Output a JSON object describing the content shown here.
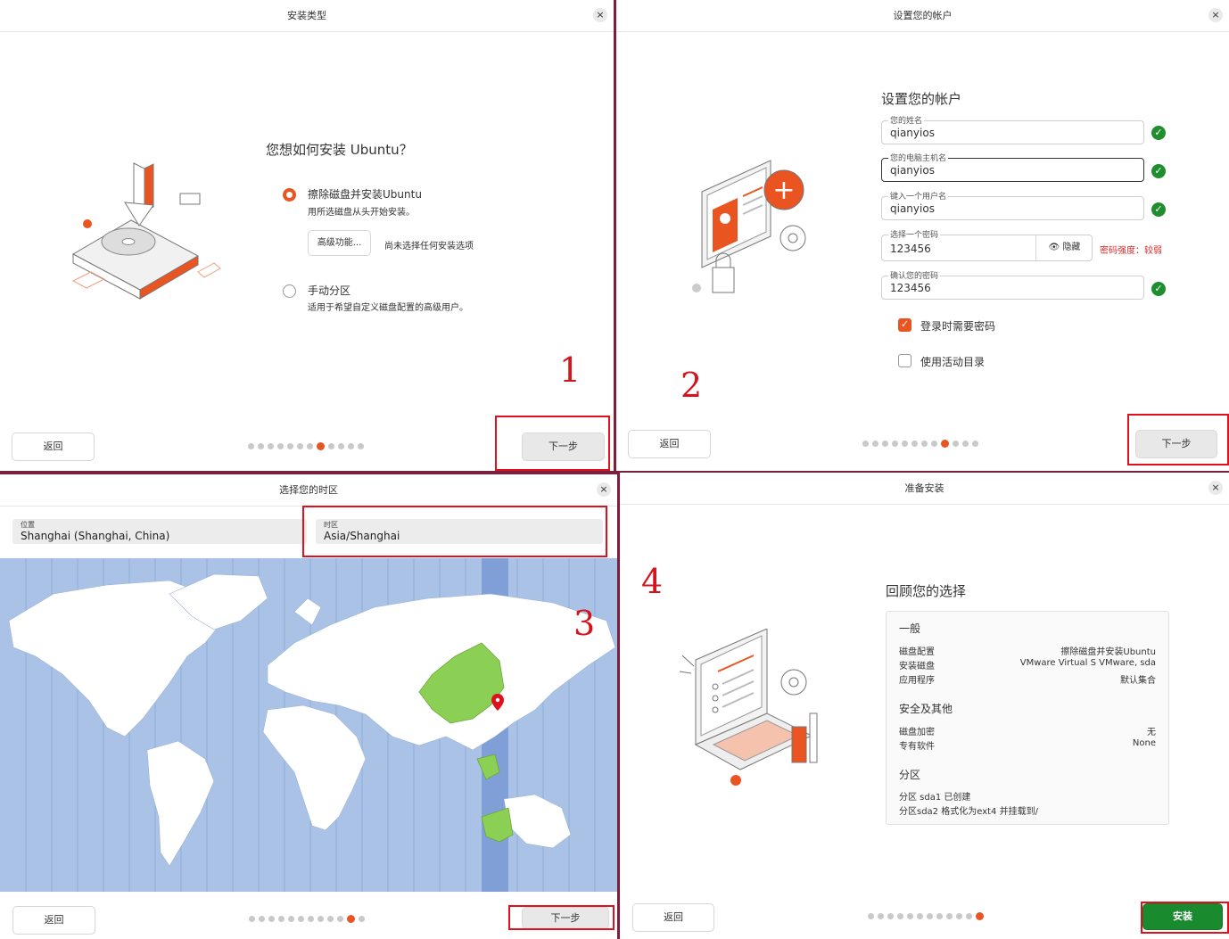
{
  "w1": {
    "title": "安装类型",
    "close": "×",
    "question": "您想如何安装 Ubuntu？",
    "option_erase": {
      "title": "擦除磁盘并安装Ubuntu",
      "desc": "用所选磁盘从头开始安装。"
    },
    "advanced_btn": "高级功能...",
    "advanced_status": "尚未选择任何安装选项",
    "option_manual": {
      "title": "手动分区",
      "desc": "适用于希望自定义磁盘配置的高级用户。"
    },
    "back": "返回",
    "next": "下一步",
    "step_label": "1"
  },
  "w2": {
    "title": "设置您的帐户",
    "close": "×",
    "heading": "设置您的帐户",
    "fields": [
      {
        "label": "您的姓名",
        "value": "qianyios",
        "valid": true
      },
      {
        "label": "您的电脑主机名",
        "value": "qianyios",
        "valid": true
      },
      {
        "label": "键入一个用户名",
        "value": "qianyios",
        "valid": true
      },
      {
        "label": "选择一个密码",
        "value": "123456"
      },
      {
        "label": "确认您的密码",
        "value": "123456",
        "valid": true
      }
    ],
    "hide_label": "隐藏",
    "strength": "密码强度：较弱",
    "require_password": "登录时需要密码",
    "active_directory": "使用活动目录",
    "check_mark": "✓",
    "back": "返回",
    "next": "下一步",
    "step_label": "2"
  },
  "w3": {
    "title": "选择您的时区",
    "close": "×",
    "location_label": "位置",
    "location_value": "Shanghai (Shanghai, China)",
    "timezone_label": "时区",
    "timezone_value": "Asia/Shanghai",
    "back": "返回",
    "next": "下一步",
    "step_label": "3"
  },
  "w4": {
    "title": "准备安装",
    "close": "×",
    "heading": "回顾您的选择",
    "general": "一般",
    "rows_general": [
      {
        "k": "磁盘配置",
        "v": "擦除磁盘并安装Ubuntu"
      },
      {
        "k": "安装磁盘",
        "v": "VMware Virtual S VMware, sda"
      },
      {
        "k": "应用程序",
        "v": "默认集合"
      }
    ],
    "security": "安全及其他",
    "rows_security": [
      {
        "k": "磁盘加密",
        "v": "无"
      },
      {
        "k": "专有软件",
        "v": "None"
      }
    ],
    "partitions": "分区",
    "part_lines": [
      "分区 sda1 已创建",
      "分区sda2 格式化为ext4 并挂载到/"
    ],
    "back": "返回",
    "install": "安装",
    "step_label": "4"
  },
  "colors": {
    "accent": "#e95420",
    "ok": "#1e8e2e",
    "install": "#198a2e",
    "annotation": "#e0111e",
    "map_ocean": "#a9c2e6",
    "map_land": "#ffffff",
    "map_selected": "#8ccf55"
  }
}
